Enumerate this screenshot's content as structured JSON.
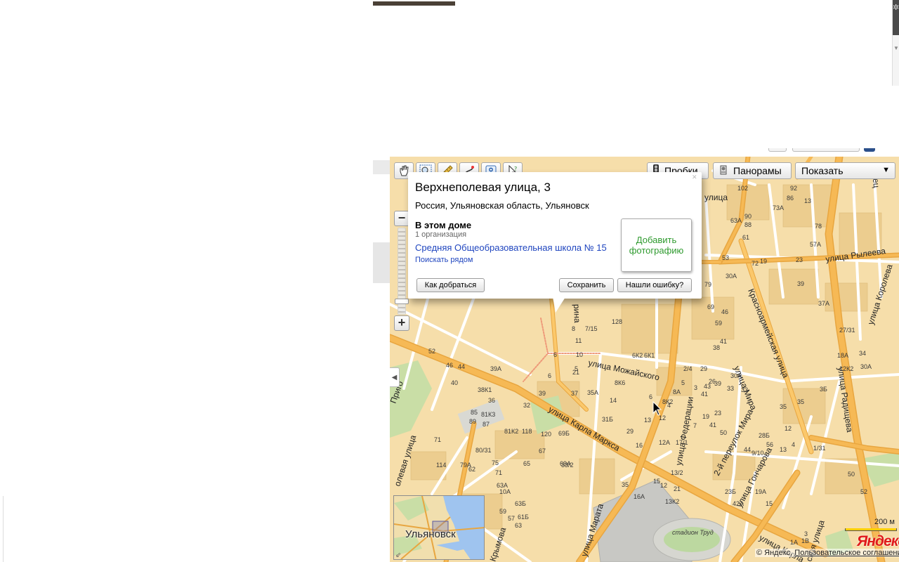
{
  "toolbar": {
    "tools": [
      {
        "name": "drag-tool"
      },
      {
        "name": "zoom-select-tool"
      },
      {
        "name": "ruler-tool"
      },
      {
        "name": "route-tool"
      },
      {
        "name": "add-object-tool"
      },
      {
        "name": "info-tool"
      }
    ],
    "traffic_label": "Пробки",
    "panoramas_label": "Панорамы",
    "show_label": "Показать"
  },
  "balloon": {
    "title": "Верхнеполевая улица, 3",
    "region": "Россия, Ульяновская область, Ульяновск",
    "in_house_heading": "В этом доме",
    "org_count": "1 организация",
    "org_name": "Средняя Общеобразовательная школа № 15",
    "search_nearby": "Поискать рядом",
    "add_photo": "Добавить фотографию",
    "directions_button": "Как добраться",
    "save_button": "Сохранить",
    "report_error_button": "Нашли ошибку?"
  },
  "map": {
    "streets": {
      "mozhayskogo": "улица Можайского",
      "karla_marksa": "улица Карла Маркса",
      "krasnoarmeyskaya": "Красноармейская улица",
      "radishcheva": "улица Радищева",
      "goncharova": "улица Гончарова",
      "marata": "улица Марата",
      "federatsii": "улица Федерации",
      "mira": "улица Мира",
      "pereulok_mira": "2-й переулок Мира",
      "ryleeva": "улица Рылеева",
      "koroleva": "улица Королева",
      "prigorod": "Приго",
      "polevaya": "олевая улица",
      "rina": "рина",
      "ulitsa": "улица",
      "venets": "Венец",
      "krymova": "Крымова",
      "karla2": "улица Карла",
      "ska": "ская улица",
      "stadium": "стадион Труд"
    },
    "house_numbers": [
      "102",
      "92",
      "73А",
      "13",
      "86",
      "90",
      "88",
      "78",
      "63А",
      "57А",
      "61",
      "53",
      "72",
      "19",
      "23",
      "30А",
      "39",
      "37А",
      "79",
      "69",
      "59",
      "46",
      "41",
      "38",
      "33",
      "27/31",
      "18А",
      "30А",
      "34",
      "12К2",
      "35",
      "3Б",
      "6К2",
      "6К1",
      "8К6",
      "2/4",
      "29",
      "26",
      "30А",
      "33",
      "23",
      "19",
      "41",
      "50",
      "52",
      "46",
      "44",
      "39А",
      "40",
      "38К1",
      "36",
      "32",
      "39",
      "37",
      "35А",
      "81К3",
      "85",
      "87",
      "89",
      "81К2",
      "118",
      "120",
      "69Б",
      "71",
      "80/31",
      "79А",
      "75",
      "114",
      "62",
      "71",
      "65",
      "67",
      "69А",
      "10А",
      "63А",
      "63Б",
      "61Б",
      "59",
      "57",
      "63",
      "33/2",
      "31Б",
      "29",
      "16",
      "12А",
      "17/1",
      "13/2",
      "21",
      "15",
      "12",
      "16А",
      "35",
      "13К2",
      "23Б",
      "42А",
      "19А",
      "15",
      "3",
      "1В",
      "1А",
      "50",
      "52",
      "44",
      "13",
      "9/10",
      "11",
      "10",
      "8",
      "7/15",
      "128",
      "6",
      "5",
      "6",
      "21",
      "14",
      "13",
      "12",
      "4",
      "8К2",
      "8А",
      "6",
      "5",
      "3",
      "7",
      "4",
      "12",
      "35",
      "28Б",
      "1/31",
      "56",
      "43",
      "41",
      "39"
    ],
    "scale_label": "200 м",
    "logo": "Яндекс",
    "copyright": "© Яндекс",
    "terms_link": "Пользовательское соглашение"
  },
  "minimap": {
    "city_label": "Ульяновск"
  }
}
